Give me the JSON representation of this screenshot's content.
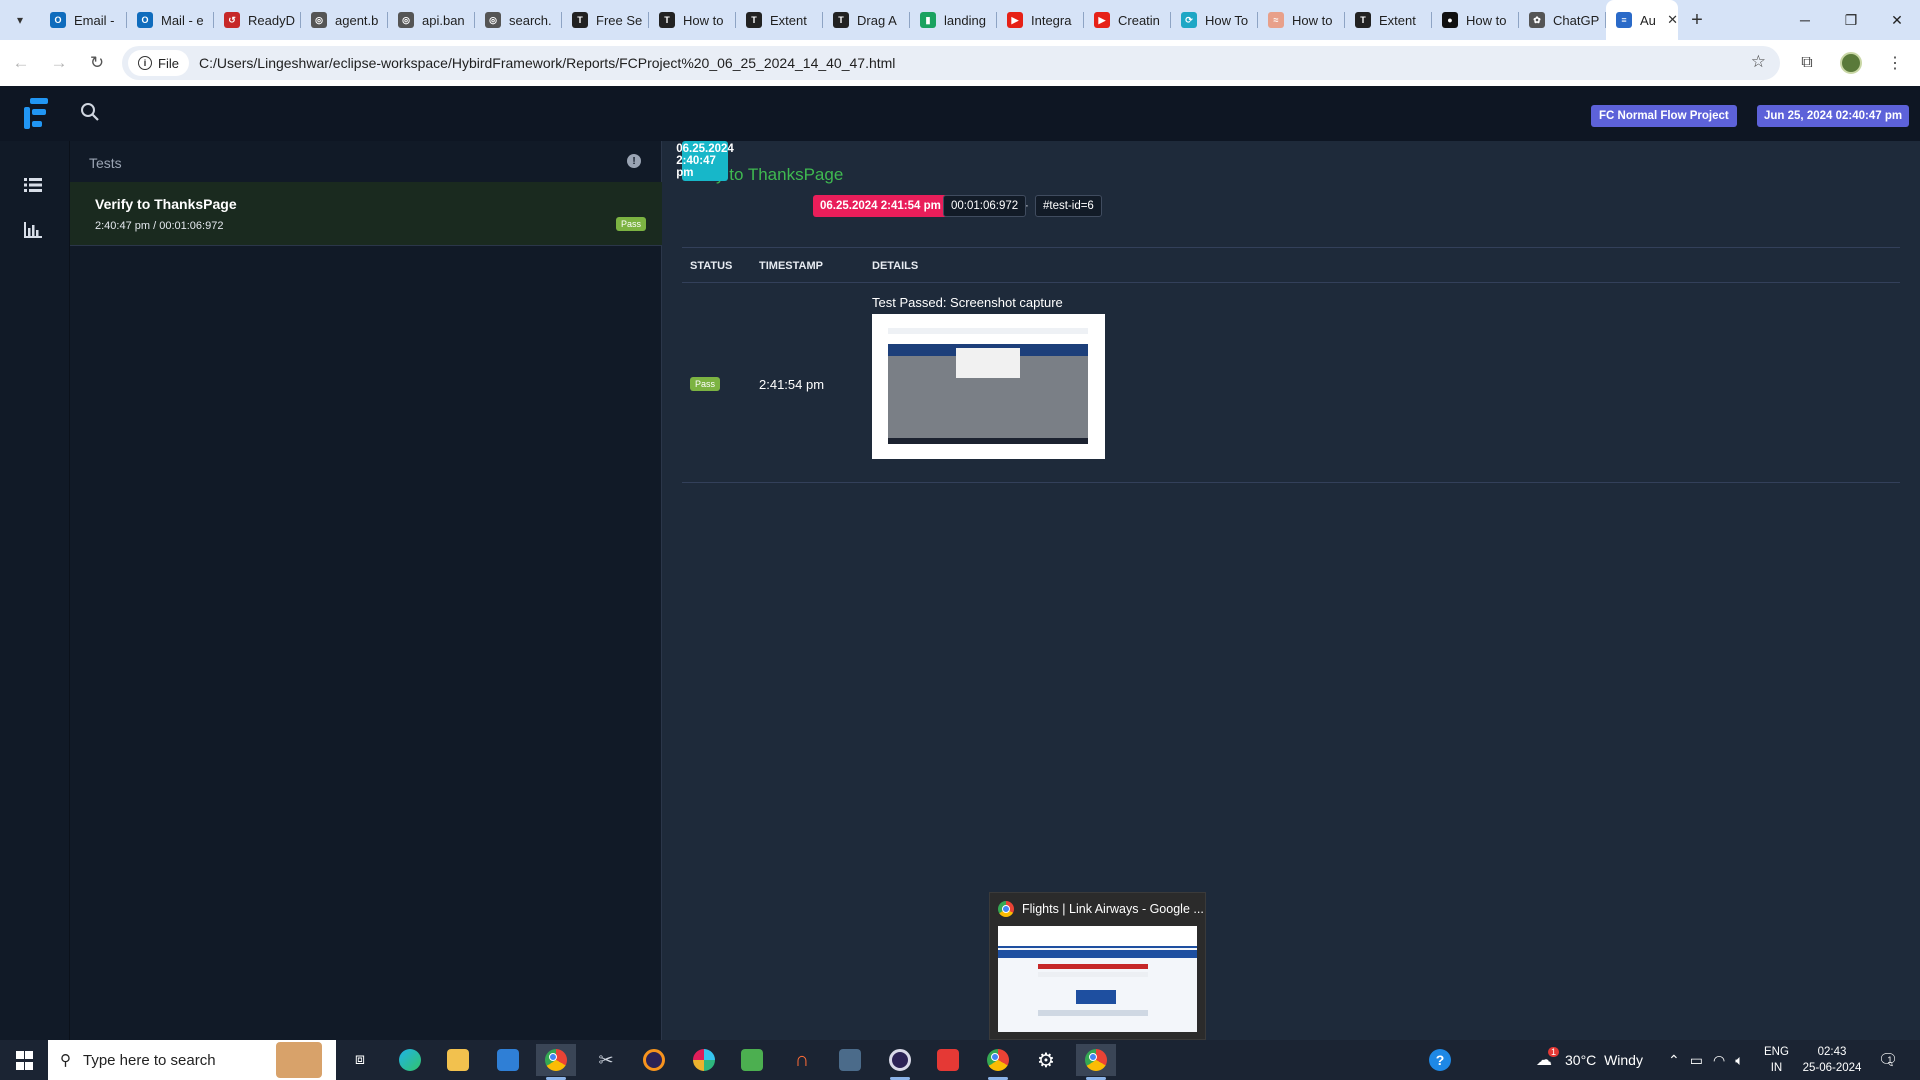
{
  "browser": {
    "tabs": [
      {
        "label": "Email -",
        "color": "#0f6cbd",
        "glyph": "O"
      },
      {
        "label": "Mail - e",
        "color": "#0f6cbd",
        "glyph": "O"
      },
      {
        "label": "ReadyD",
        "color": "#c62828",
        "glyph": "↺"
      },
      {
        "label": "agent.b",
        "color": "#555555",
        "glyph": "◎"
      },
      {
        "label": "api.ban",
        "color": "#555555",
        "glyph": "◎"
      },
      {
        "label": "search.",
        "color": "#555555",
        "glyph": "◎"
      },
      {
        "label": "Free Se",
        "color": "#222222",
        "glyph": "T"
      },
      {
        "label": "How to",
        "color": "#222222",
        "glyph": "T"
      },
      {
        "label": "Extent",
        "color": "#222222",
        "glyph": "T"
      },
      {
        "label": "Drag A",
        "color": "#222222",
        "glyph": "T"
      },
      {
        "label": "landing",
        "color": "#1aa260",
        "glyph": "▮"
      },
      {
        "label": "Integra",
        "color": "#e62117",
        "glyph": "▶"
      },
      {
        "label": "Creatin",
        "color": "#e62117",
        "glyph": "▶"
      },
      {
        "label": "How To",
        "color": "#1ea7c5",
        "glyph": "⟳"
      },
      {
        "label": "How to",
        "color": "#e8a08a",
        "glyph": "≈"
      },
      {
        "label": "Extent",
        "color": "#222222",
        "glyph": "T"
      },
      {
        "label": "How to",
        "color": "#111111",
        "glyph": "●"
      },
      {
        "label": "ChatGP",
        "color": "#555555",
        "glyph": "✿"
      }
    ],
    "active_tab": {
      "label": "Au",
      "color": "#2a6ac8",
      "glyph": "≡"
    },
    "address": {
      "scheme_label": "File",
      "url": "C:/Users/Lingeshwar/eclipse-workspace/HybirdFramework/Reports/FCProject%20_06_25_2024_14_40_47.html"
    }
  },
  "header": {
    "project_badge": "FC Normal Flow Project",
    "date_badge": "Jun 25, 2024 02:40:47 pm"
  },
  "tests_panel": {
    "title": "Tests",
    "items": [
      {
        "name": "Verify to ThanksPage",
        "meta": "2:40:47 pm / 00:01:06:972",
        "status": "Pass"
      }
    ]
  },
  "detail": {
    "title": "Verify to ThanksPage",
    "start_time": "06.25.2024 2:40:47 pm",
    "end_time": "06.25.2024 2:41:54 pm",
    "duration": "00:01:06:972",
    "separator": "·",
    "test_id": "#test-id=6",
    "columns": [
      "STATUS",
      "TIMESTAMP",
      "DETAILS"
    ],
    "logs": [
      {
        "status": "Pass",
        "timestamp": "2:41:54 pm",
        "details": "Test Passed: Screenshot capture"
      }
    ]
  },
  "preview": {
    "title": "Flights | Link Airways - Google ..."
  },
  "taskbar": {
    "search_placeholder": "Type here to search",
    "weather": "30°C  Windy",
    "weather_alert": "1",
    "lang_top": "ENG",
    "lang_bottom": "IN",
    "time": "02:43",
    "date": "25-06-2024",
    "notifications": "1"
  },
  "colors": {
    "pass": "#7cb342",
    "accent_indigo": "#5d62d9",
    "start_tag": "#17b7c9",
    "end_tag": "#e91e5a",
    "title_green": "#3fb950"
  }
}
